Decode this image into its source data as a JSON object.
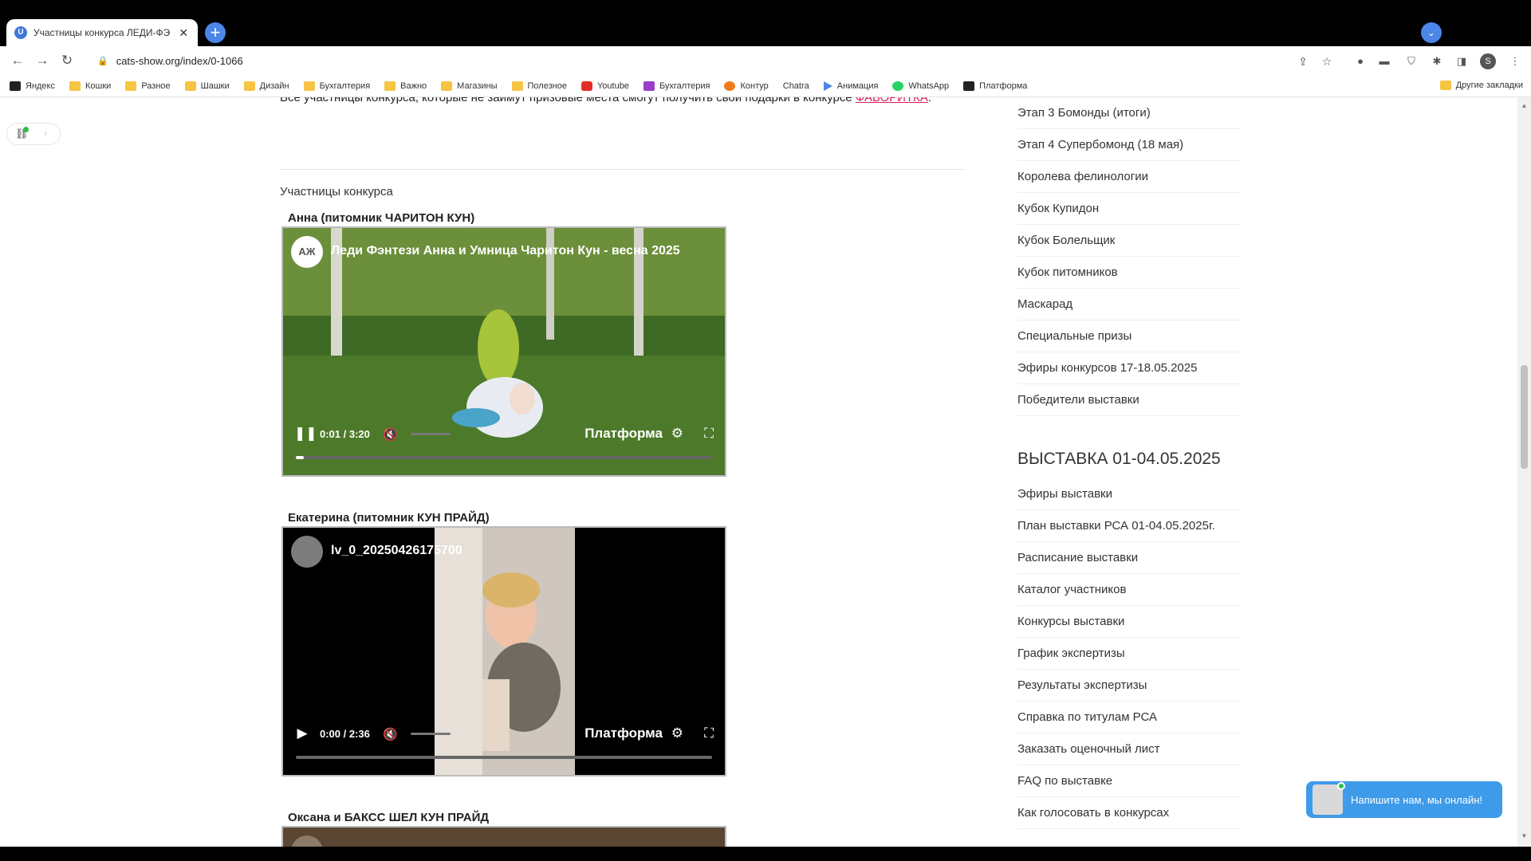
{
  "browser": {
    "tab_title": "Участницы конкурса ЛЕДИ-ФЭ",
    "favicon_letter": "U",
    "new_tab_icon": "+",
    "tab_search_icon": "⌄",
    "url": "cats-show.org/index/0-1066",
    "profile_letter": "S",
    "bookmarks": [
      {
        "label": "Яндекс",
        "icon": "dark"
      },
      {
        "label": "Кошки",
        "icon": "folder"
      },
      {
        "label": "Разное",
        "icon": "folder"
      },
      {
        "label": "Шашки",
        "icon": "folder"
      },
      {
        "label": "Дизайн",
        "icon": "folder"
      },
      {
        "label": "Бухгалтерия",
        "icon": "folder"
      },
      {
        "label": "Важно",
        "icon": "folder"
      },
      {
        "label": "Магазины",
        "icon": "folder"
      },
      {
        "label": "Полезное",
        "icon": "folder"
      },
      {
        "label": "Youtube",
        "icon": "red"
      },
      {
        "label": "Бухгалтерия",
        "icon": "purple"
      },
      {
        "label": "Контур",
        "icon": "orange"
      },
      {
        "label": "Chatra",
        "icon": "chat"
      },
      {
        "label": "Анимация",
        "icon": "blue"
      },
      {
        "label": "WhatsApp",
        "icon": "green"
      },
      {
        "label": "Платформа",
        "icon": "dark"
      }
    ],
    "other_bookmarks": "Другие закладки"
  },
  "page": {
    "intro_text": "Все участницы конкурса, которые не займут призовые места смогут получить свои подарки в конкурсе",
    "intro_link": "ФАВОРИТКА",
    "section_title": "Участницы конкурса",
    "entries": [
      {
        "label": "Анна (питомник ЧАРИТОН КУН)",
        "avatar": "АЖ",
        "video_title": "Леди Фэнтези Анна и Умница Чаритон Кун - весна 2025",
        "time": "0:01 / 3:20",
        "control_icon": "❚❚",
        "brand": "Платформа",
        "progress": 0.02
      },
      {
        "label": "Екатерина (питомник КУН ПРАЙД)",
        "avatar": "",
        "video_title": "lv_0_20250426175700",
        "time": "0:00 / 2:36",
        "control_icon": "▶",
        "brand": "Платформа",
        "progress": 0
      },
      {
        "label": "Оксана и БАКСС ШЕЛ КУН ПРАЙД"
      }
    ]
  },
  "sidebar": {
    "links_top": [
      "Этап 3 Бомонды (итоги)",
      "Этап 4 Супербомонд (18 мая)",
      "Королева фелинологии",
      "Кубок Купидон",
      "Кубок Болельщик",
      "Кубок питомников",
      "Маскарад",
      "Специальные призы",
      "Эфиры конкурсов 17-18.05.2025",
      "Победители выставки"
    ],
    "heading": "ВЫСТАВКА 01-04.05.2025",
    "links_bottom": [
      "Эфиры выставки",
      "План выставки РСА 01-04.05.2025г.",
      "Расписание выставки",
      "Каталог участников",
      "Конкурсы выставки",
      "График экспертизы",
      "Результаты экспертизы",
      "Справка по титулам РСА",
      "Заказать оценочный лист",
      "FAQ по выставке",
      "Как голосовать в конкурсах"
    ]
  },
  "chat": {
    "text": "Напишите нам, мы онлайн!"
  }
}
